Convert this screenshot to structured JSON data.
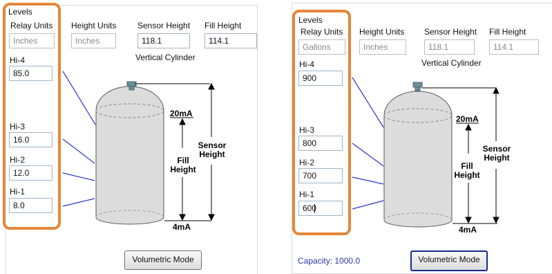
{
  "left": {
    "levels_label": "Levels",
    "relay_units_label": "Relay Units",
    "relay_units_value": "Inches",
    "height_units_label": "Height Units",
    "height_units_value": "Inches",
    "sensor_height_label": "Sensor Height",
    "sensor_height_value": "118.1",
    "fill_height_label": "Fill Height",
    "fill_height_value": "114.1",
    "tank_type": "Vertical Cylinder",
    "levels": [
      {
        "label": "Hi-4",
        "value": "85.0"
      },
      {
        "label": "Hi-3",
        "value": "16.0"
      },
      {
        "label": "Hi-2",
        "value": "12.0"
      },
      {
        "label": "Hi-1",
        "value": "8.0"
      }
    ],
    "diagram": {
      "top_current": "20mA",
      "bottom_current": "4mA",
      "fill_height": "Fill\nHeight",
      "sensor_height": "Sensor\nHeight"
    },
    "mode_button": "Volumetric Mode"
  },
  "right": {
    "levels_label": "Levels",
    "relay_units_label": "Relay Units",
    "relay_units_value": "Gallons",
    "height_units_label": "Height Units",
    "height_units_value": "Inches",
    "sensor_height_label": "Sensor Height",
    "sensor_height_value": "118.1",
    "fill_height_label": "Fill Height",
    "fill_height_value": "114.1",
    "tank_type": "Vertical Cylinder",
    "levels": [
      {
        "label": "Hi-4",
        "value": "900"
      },
      {
        "label": "Hi-3",
        "value": "800"
      },
      {
        "label": "Hi-2",
        "value": "700"
      },
      {
        "label": "Hi-1",
        "value": "600"
      }
    ],
    "diagram": {
      "top_current": "20mA",
      "bottom_current": "4mA",
      "fill_height": "Fill\nHeight",
      "sensor_height": "Sensor\nHeight"
    },
    "capacity": "Capacity: 1000.0",
    "mode_button": "Volumetric Mode"
  },
  "colors": {
    "highlight": "#e5863a",
    "link": "#2a37a8",
    "button_focus": "#1a2a8c",
    "leader_line": "#2b35c8"
  }
}
